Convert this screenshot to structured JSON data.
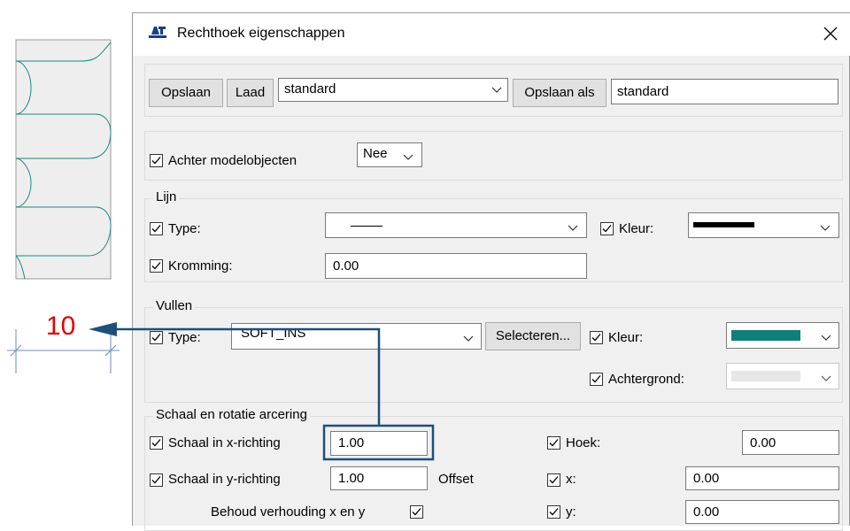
{
  "dialog": {
    "title": "Rechthoek eigenschappen",
    "toolbar": {
      "save_label": "Opslaan",
      "load_label": "Laad",
      "preset_value": "standard",
      "save_as_label": "Opslaan als",
      "save_as_value": "standard"
    },
    "behind": {
      "label": "Achter modelobjecten",
      "value": "Nee",
      "checked": true
    },
    "line": {
      "title": "Lijn",
      "type_label": "Type:",
      "color_label": "Kleur:",
      "curve_label": "Kromming:",
      "curve_value": "0.00",
      "line_color": "#000000"
    },
    "fill": {
      "title": "Vullen",
      "type_label": "Type:",
      "type_value": "SOFT_INS",
      "select_label": "Selecteren...",
      "color_label": "Kleur:",
      "background_label": "Achtergrond:",
      "fill_color": "#0f7f7a",
      "background_color": "#e6e6e6"
    },
    "hatch": {
      "title": "Schaal en rotatie arcering",
      "scale_x_label": "Schaal in x-richting",
      "scale_x_value": "1.00",
      "scale_y_label": "Schaal in y-richting",
      "scale_y_value": "1.00",
      "offset_label": "Offset",
      "keep_ratio_label": "Behoud verhouding x en y",
      "angle_label": "Hoek:",
      "angle_value": "0.00",
      "x_label": "x:",
      "x_value": "0.00",
      "y_label": "y:",
      "y_value": "0.00"
    }
  },
  "annotation": {
    "callout_value": "10",
    "callout_color": "#e00000",
    "arrow_color": "#1f4e79"
  },
  "preview": {
    "hatch_color": "#1a8a80"
  }
}
